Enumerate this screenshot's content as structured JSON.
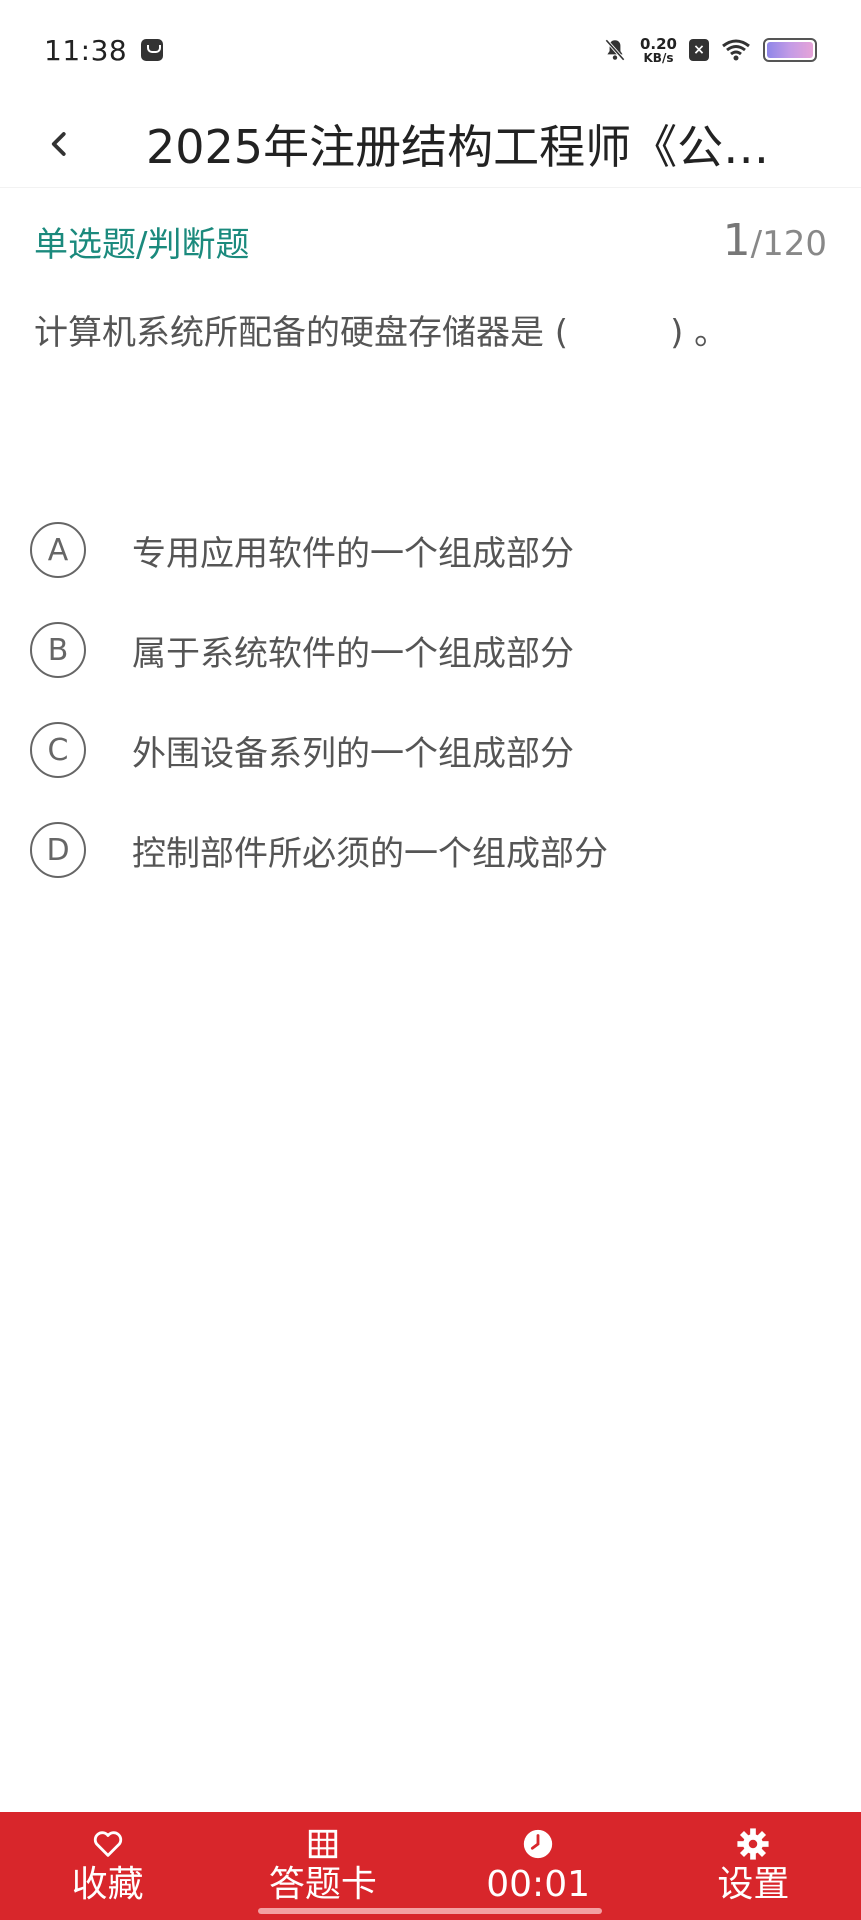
{
  "status_bar": {
    "time": "11:38",
    "net_speed_value": "0.20",
    "net_speed_unit": "KB/s"
  },
  "header": {
    "title": "2025年注册结构工程师《公…"
  },
  "question": {
    "type_label": "单选题/判断题",
    "current": "1",
    "separator_total": "/120",
    "text": "计算机系统所配备的硬盘存储器是 (　　　) 。",
    "options": [
      {
        "letter": "A",
        "text": "专用应用软件的一个组成部分"
      },
      {
        "letter": "B",
        "text": "属于系统软件的一个组成部分"
      },
      {
        "letter": "C",
        "text": "外围设备系列的一个组成部分"
      },
      {
        "letter": "D",
        "text": "控制部件所必须的一个组成部分"
      }
    ]
  },
  "bottom_bar": {
    "favorite_label": "收藏",
    "answer_card_label": "答题卡",
    "timer_label": "00:01",
    "settings_label": "设置"
  },
  "colors": {
    "accent_teal": "#1b8a7d",
    "bottom_bar_red": "#d8262b"
  }
}
